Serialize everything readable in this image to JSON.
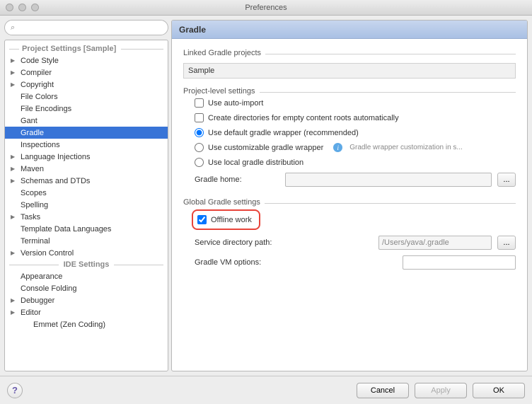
{
  "window": {
    "title": "Preferences"
  },
  "search": {
    "placeholder": ""
  },
  "sidebar": {
    "project_section": "Project Settings [Sample]",
    "ide_section": "IDE Settings",
    "items": [
      {
        "label": "Code Style",
        "level": 1,
        "children": true
      },
      {
        "label": "Compiler",
        "level": 1,
        "children": true
      },
      {
        "label": "Copyright",
        "level": 1,
        "children": true
      },
      {
        "label": "File Colors",
        "level": 1,
        "children": false
      },
      {
        "label": "File Encodings",
        "level": 1,
        "children": false
      },
      {
        "label": "Gant",
        "level": 1,
        "children": false
      },
      {
        "label": "Gradle",
        "level": 1,
        "children": false,
        "selected": true
      },
      {
        "label": "Inspections",
        "level": 1,
        "children": false
      },
      {
        "label": "Language Injections",
        "level": 1,
        "children": true
      },
      {
        "label": "Maven",
        "level": 1,
        "children": true
      },
      {
        "label": "Schemas and DTDs",
        "level": 1,
        "children": true
      },
      {
        "label": "Scopes",
        "level": 1,
        "children": false
      },
      {
        "label": "Spelling",
        "level": 1,
        "children": false
      },
      {
        "label": "Tasks",
        "level": 1,
        "children": true
      },
      {
        "label": "Template Data Languages",
        "level": 1,
        "children": false
      },
      {
        "label": "Terminal",
        "level": 1,
        "children": false
      },
      {
        "label": "Version Control",
        "level": 1,
        "children": true
      }
    ],
    "ide_items": [
      {
        "label": "Appearance",
        "level": 1,
        "children": false
      },
      {
        "label": "Console Folding",
        "level": 1,
        "children": false
      },
      {
        "label": "Debugger",
        "level": 1,
        "children": true
      },
      {
        "label": "Editor",
        "level": 1,
        "children": true
      },
      {
        "label": "Emmet (Zen Coding)",
        "level": 2,
        "children": false
      }
    ]
  },
  "panel": {
    "title": "Gradle",
    "linked_legend": "Linked Gradle projects",
    "linked_project": "Sample",
    "project_legend": "Project-level settings",
    "auto_import": "Use auto-import",
    "create_dirs": "Create directories for empty content roots automatically",
    "default_wrapper": "Use default gradle wrapper (recommended)",
    "custom_wrapper": "Use customizable gradle wrapper",
    "custom_hint": "Gradle wrapper customization in s...",
    "local_dist": "Use local gradle distribution",
    "gradle_home": "Gradle home:",
    "global_legend": "Global Gradle settings",
    "offline": "Offline work",
    "service_dir": "Service directory path:",
    "service_dir_value": "/Users/yava/.gradle",
    "vm_options": "Gradle VM options:"
  },
  "footer": {
    "help": "?",
    "cancel": "Cancel",
    "apply": "Apply",
    "ok": "OK"
  }
}
